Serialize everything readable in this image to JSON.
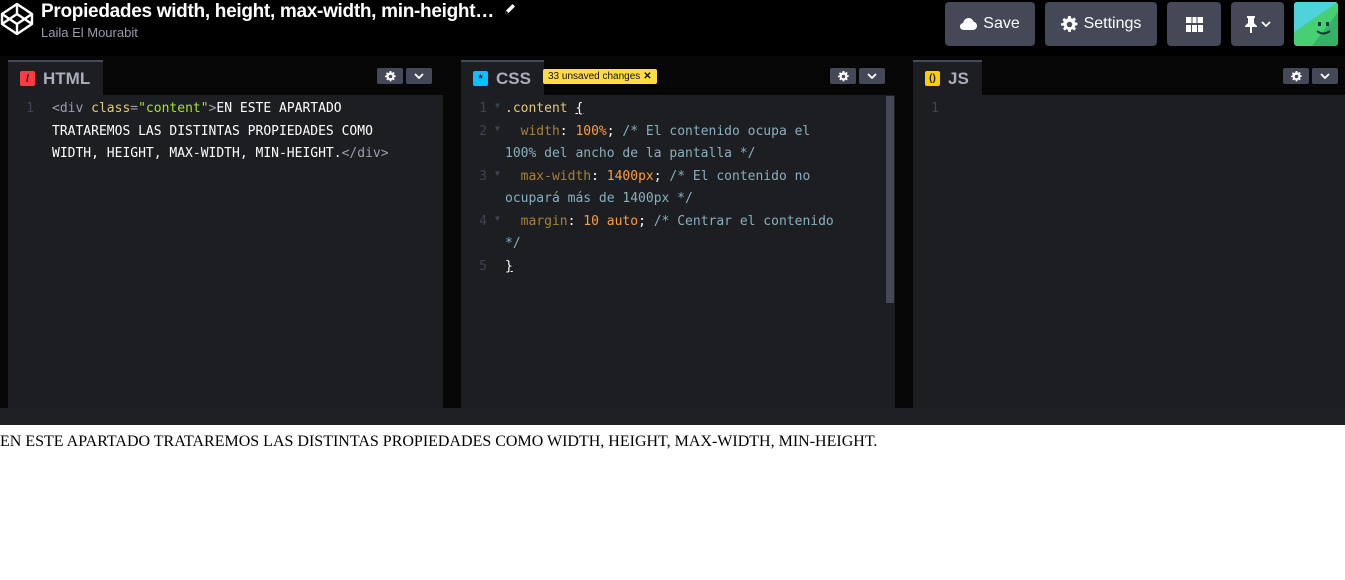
{
  "header": {
    "title": "Propiedades width, height, max-width, min-height…",
    "author": "Laila El Mourabit",
    "save_label": "Save",
    "settings_label": "Settings"
  },
  "html_panel": {
    "label": "HTML",
    "icon_glyph": "/",
    "color": "#ff3c41",
    "line_numbers": [
      "1"
    ]
  },
  "css_panel": {
    "label": "CSS",
    "icon_glyph": "*",
    "color": "#0ebeff",
    "unsaved_badge": "33 unsaved changes",
    "line_numbers": [
      "1",
      "2",
      "3",
      "4",
      "5"
    ]
  },
  "js_panel": {
    "label": "JS",
    "icon_glyph": "()",
    "color": "#fcd000",
    "line_numbers": [
      "1"
    ]
  },
  "html_code": {
    "l1a_tag_open": "<div ",
    "l1a_attr": "class",
    "l1a_eq": "=",
    "l1a_str": "\"content\"",
    "l1a_gt": ">",
    "l1a_text": "EN ESTE APARTADO",
    "l1b_text": "TRATAREMOS LAS DISTINTAS PROPIEDADES COMO",
    "l1c_text": "WIDTH, HEIGHT, MAX-WIDTH, MIN-HEIGHT.",
    "l1c_close": "</div>"
  },
  "css_code": {
    "l1_sel": ".content",
    "l1_brace": "{",
    "l2_prop": "width",
    "l2_colon": ": ",
    "l2_val": "100%",
    "l2_semi": "; ",
    "l2_cmt_a": "/* El contenido ocupa el",
    "l2_cmt_b": "100% del ancho de la pantalla */",
    "l3_prop": "max-width",
    "l3_colon": ": ",
    "l3_val": "1400px",
    "l3_semi": "; ",
    "l3_cmt_a": "/* El contenido no",
    "l3_cmt_b": "ocupará más de 1400px */",
    "l4_prop": "margin",
    "l4_colon": ": ",
    "l4_val_num": "10",
    "l4_val_kw": "auto",
    "l4_semi": "; ",
    "l4_cmt_a": "/* Centrar el contenido",
    "l4_cmt_b": "*/",
    "l5_brace": "}"
  },
  "preview": {
    "text": "EN ESTE APARTADO TRATAREMOS LAS DISTINTAS PROPIEDADES COMO WIDTH, HEIGHT, MAX-WIDTH, MIN-HEIGHT."
  },
  "colors": {
    "header_bg": "#000000",
    "button_bg": "#444857",
    "editor_bg": "#1d1e22",
    "badge_bg": "#ffdd40"
  }
}
